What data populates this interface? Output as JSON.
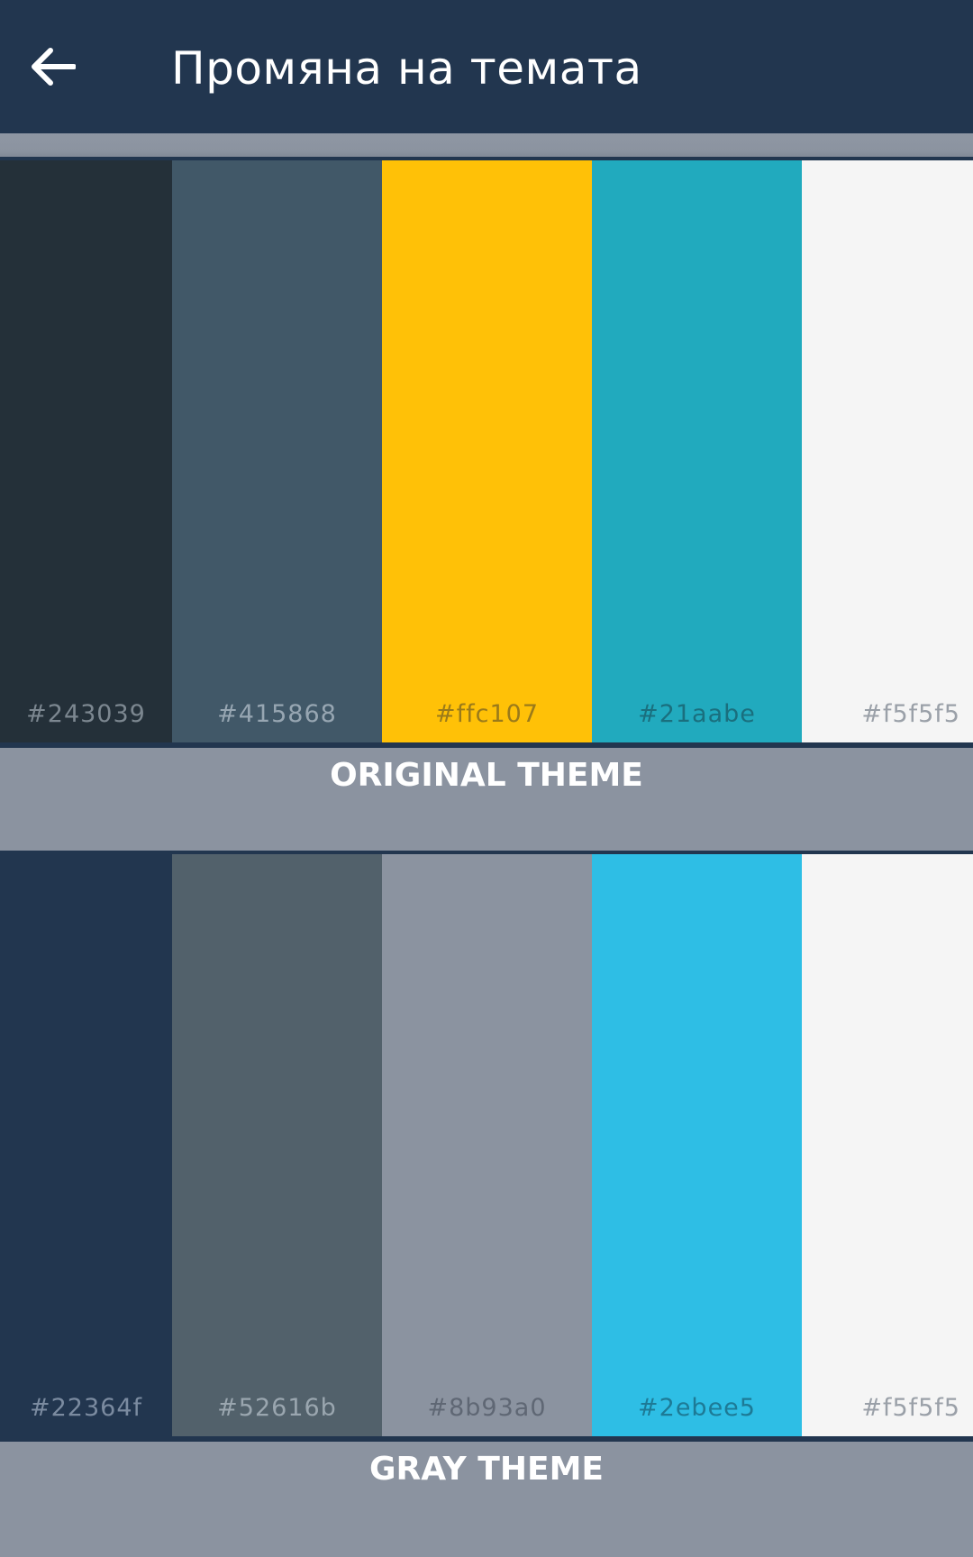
{
  "appbar": {
    "title": "Промяна на темата",
    "back_icon": "arrow-left-icon"
  },
  "themes": [
    {
      "label": "ORIGINAL THEME",
      "swatches": [
        {
          "hex": "#243039",
          "color": "#243039",
          "text_color": "#7c8790"
        },
        {
          "hex": "#415868",
          "color": "#415868",
          "text_color": "#97a6b2"
        },
        {
          "hex": "#ffc107",
          "color": "#ffc107",
          "text_color": "#9a7a1a"
        },
        {
          "hex": "#21aabe",
          "color": "#21aabe",
          "text_color": "#1a6f7e"
        },
        {
          "hex": "#f5f5f5",
          "color": "#f5f5f5",
          "text_color": "#9aa0a8"
        }
      ]
    },
    {
      "label": "GRAY THEME",
      "swatches": [
        {
          "hex": "#22364f",
          "color": "#22364f",
          "text_color": "#7b8ba0"
        },
        {
          "hex": "#52616b",
          "color": "#52616b",
          "text_color": "#9aa6af"
        },
        {
          "hex": "#8b93a0",
          "color": "#8b93a0",
          "text_color": "#5f6774"
        },
        {
          "hex": "#2ebee5",
          "color": "#2ebee5",
          "text_color": "#1d7a96"
        },
        {
          "hex": "#f5f5f5",
          "color": "#f5f5f5",
          "text_color": "#9aa0a8"
        }
      ]
    }
  ]
}
